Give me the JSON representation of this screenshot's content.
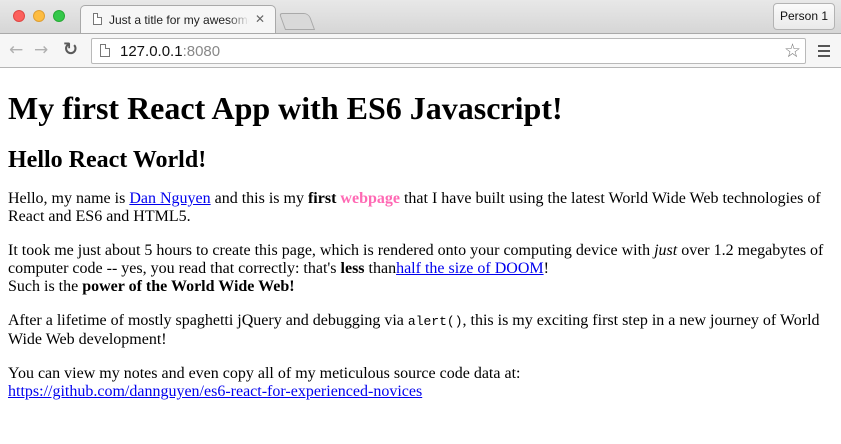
{
  "browser": {
    "tab_title": "Just a title for my awesome webpage",
    "tab_close": "✕",
    "person_label": "Person 1",
    "url_host": "127.0.0.1",
    "url_port": ":8080"
  },
  "page": {
    "heading1": "My first React App with ES6 Javascript!",
    "heading2": "Hello React World!",
    "p1": {
      "t1": "Hello, my name is ",
      "link_name": "Dan Nguyen",
      "t2": " and this is my ",
      "bold_first": "first",
      "t3": " ",
      "pink_word": "webpage",
      "t4": " that I have built using the latest World Wide Web technologies of React and ES6 and HTML5."
    },
    "p2": {
      "t1": "It took me just about 5 hours to create this page, which is rendered onto your computing device with ",
      "italic_just": "just",
      "t2": " over 1.2 megabytes of computer code -- yes, you read that correctly: that's ",
      "bold_less": "less",
      "t3": " than",
      "link_doom": "half the size of DOOM",
      "t4": "!",
      "t5": "Such is the ",
      "bold_power": "power of the World Wide Web!"
    },
    "p3": {
      "t1": "After a lifetime of mostly spaghetti jQuery and debugging via ",
      "code": "alert()",
      "t2": ", this is my exciting first step in a new journey of World Wide Web development!"
    },
    "p4": {
      "t1": "You can view my notes and even copy all of my meticulous source code data at:",
      "link_repo": "https://github.com/dannguyen/es6-react-for-experienced-novices"
    }
  }
}
